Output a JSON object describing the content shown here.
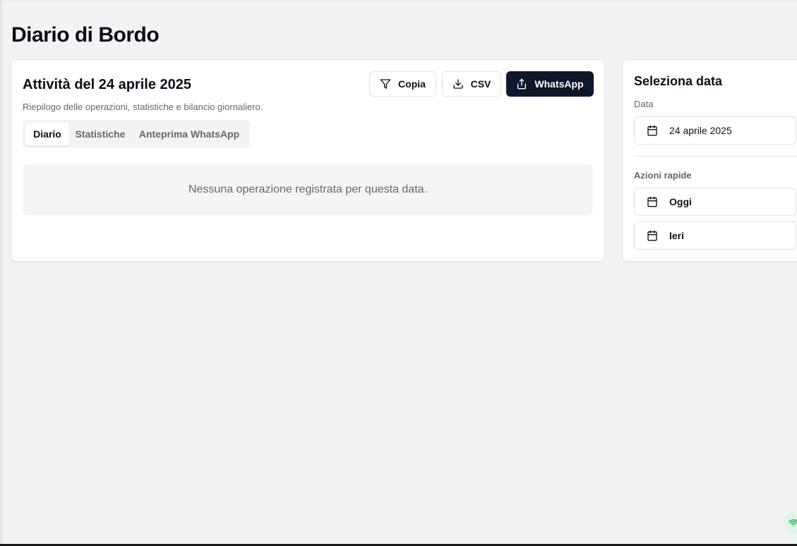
{
  "page": {
    "title": "Diario di Bordo"
  },
  "main": {
    "title": "Attività del 24 aprile 2025",
    "subtitle": "Riepilogo delle operazioni, statistiche e bilancio giornaliero.",
    "actions": {
      "copy_label": "Copia",
      "csv_label": "CSV",
      "whatsapp_label": "WhatsApp"
    },
    "tabs": [
      {
        "label": "Diario",
        "active": true
      },
      {
        "label": "Statistiche",
        "active": false
      },
      {
        "label": "Anteprima WhatsApp",
        "active": false
      }
    ],
    "empty_message": "Nessuna operazione registrata per questa data."
  },
  "side": {
    "title": "Seleziona data",
    "date_label": "Data",
    "date_value": "24 aprile 2025",
    "quick_actions_label": "Azioni rapide",
    "quick_actions": [
      {
        "label": "Oggi"
      },
      {
        "label": "Ieri"
      }
    ]
  },
  "icons": {
    "copy": "filter-icon",
    "csv": "download-icon",
    "whatsapp": "share-upload-icon",
    "date": "calendar-icon",
    "status": "wifi-icon"
  },
  "colors": {
    "primary": "#0f172a",
    "background": "#f2f3f5",
    "muted_text": "#6b6660",
    "status_badge": "#dff5e7",
    "status_icon": "#16a34a"
  }
}
